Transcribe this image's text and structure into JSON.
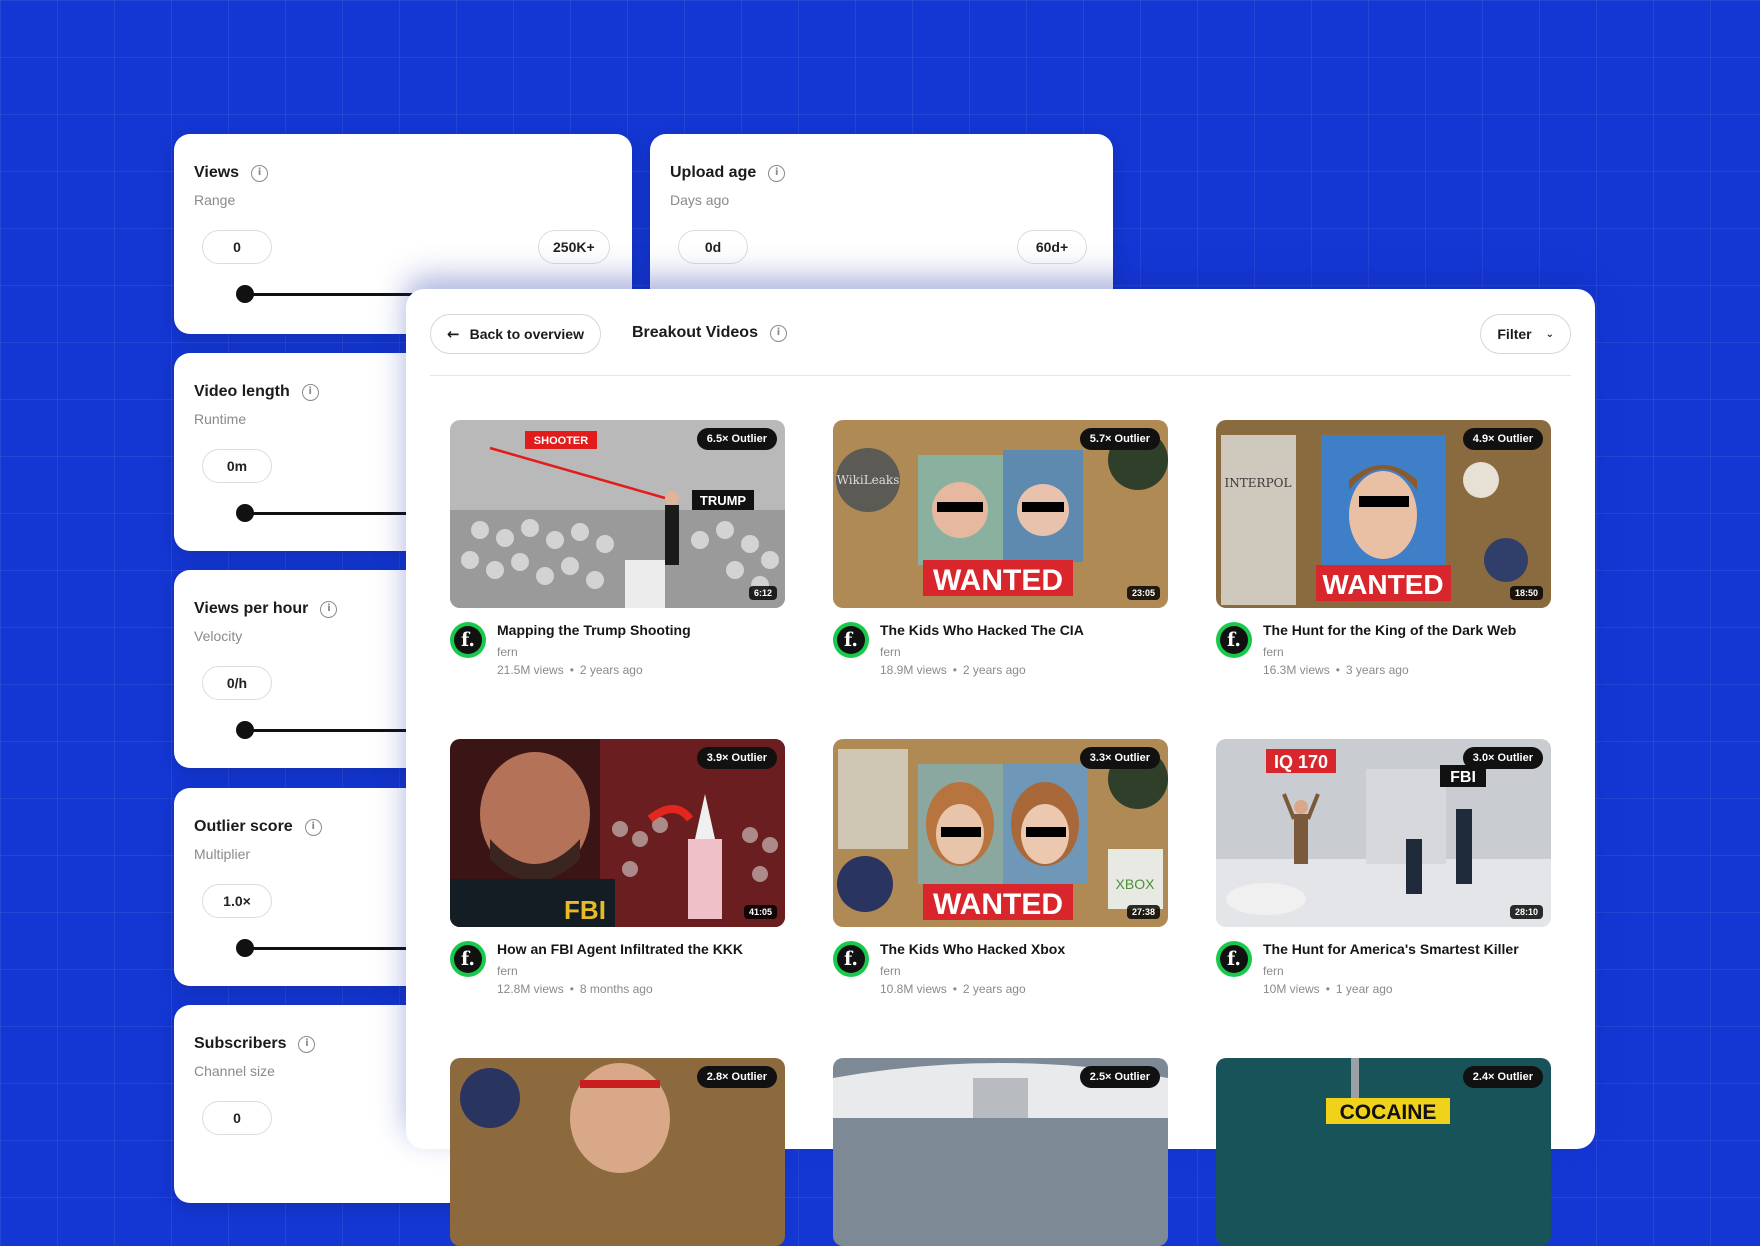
{
  "filters": [
    {
      "title": "Views",
      "subtitle": "Range",
      "min": "0",
      "max": "250K+"
    },
    {
      "title": "Upload age",
      "subtitle": "Days ago",
      "min": "0d",
      "max": "60d+"
    },
    {
      "title": "Video length",
      "subtitle": "Runtime",
      "min": "0m"
    },
    {
      "title": "Views per hour",
      "subtitle": "Velocity",
      "min": "0/h"
    },
    {
      "title": "Outlier score",
      "subtitle": "Multiplier",
      "min": "1.0×"
    },
    {
      "title": "Subscribers",
      "subtitle": "Channel size",
      "min": "0"
    }
  ],
  "panel": {
    "back_label": "Back to overview",
    "title": "Breakout Videos",
    "filter_label": "Filter"
  },
  "videos": [
    {
      "title": "Mapping the Trump Shooting",
      "channel": "fern",
      "views": "21.5M views",
      "age": "2 years ago",
      "outlier": "6.5× Outlier",
      "duration": "6:12",
      "thumb_text": [
        "SHOOTER",
        "TRUMP"
      ]
    },
    {
      "title": "The Kids Who Hacked The CIA",
      "channel": "fern",
      "views": "18.9M views",
      "age": "2 years ago",
      "outlier": "5.7× Outlier",
      "duration": "23:05",
      "thumb_text": [
        "WANTED",
        "WikiLeaks"
      ]
    },
    {
      "title": "The Hunt for the King of the Dark Web",
      "channel": "fern",
      "views": "16.3M views",
      "age": "3 years ago",
      "outlier": "4.9× Outlier",
      "duration": "18:50",
      "thumb_text": [
        "WANTED",
        "INTERPOL"
      ]
    },
    {
      "title": "How an FBI Agent Infiltrated the KKK",
      "channel": "fern",
      "views": "12.8M views",
      "age": "8 months ago",
      "outlier": "3.9× Outlier",
      "duration": "41:05",
      "thumb_text": [
        "FBI"
      ]
    },
    {
      "title": "The Kids Who Hacked Xbox",
      "channel": "fern",
      "views": "10.8M views",
      "age": "2 years ago",
      "outlier": "3.3× Outlier",
      "duration": "27:38",
      "thumb_text": [
        "WANTED",
        "XBOX"
      ]
    },
    {
      "title": "The Hunt for America's Smartest Killer",
      "channel": "fern",
      "views": "10M views",
      "age": "1 year ago",
      "outlier": "3.0× Outlier",
      "duration": "28:10",
      "thumb_text": [
        "IQ 170",
        "FBI"
      ]
    },
    {
      "outlier": "2.8× Outlier"
    },
    {
      "outlier": "2.5× Outlier"
    },
    {
      "outlier": "2.4× Outlier",
      "thumb_text": [
        "COCAINE"
      ]
    }
  ],
  "avatar_letter": "f.",
  "colors": {
    "background": "#1437d4",
    "avatar": "#19c94b",
    "wanted_red": "#d8262c"
  }
}
